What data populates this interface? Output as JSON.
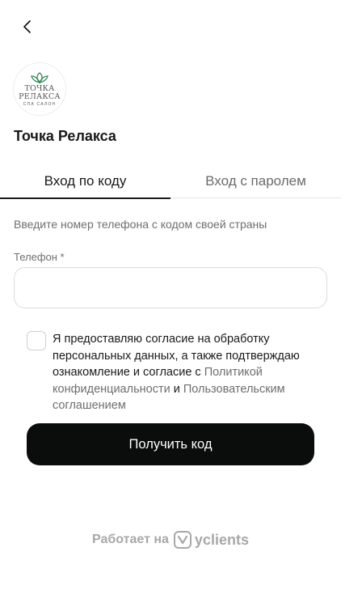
{
  "header": {
    "back_icon": "chevron-left-icon"
  },
  "logo": {
    "line1": "ТОЧКА",
    "line2": "РЕЛАКСА",
    "line3": "СПА САЛОН",
    "accent": "#2e8b57"
  },
  "salon": {
    "name": "Точка Релакса"
  },
  "tabs": [
    {
      "label": "Вход по коду",
      "active": true
    },
    {
      "label": "Вход с паролем",
      "active": false
    }
  ],
  "form": {
    "hint": "Введите номер телефона с кодом своей страны",
    "phone_label": "Телефон *",
    "phone_value": "",
    "phone_placeholder": ""
  },
  "consent": {
    "text_before": "Я предоставляю согласие на обработку персональных данных, а также подтверждаю ознакомление и согласие с ",
    "privacy_link": "Политикой конфиденциальности",
    "text_middle": " и ",
    "terms_link": "Пользовательским соглашением"
  },
  "submit": {
    "label": "Получить код"
  },
  "footer": {
    "powered_by": "Работает на",
    "brand": "yclients",
    "brand_icon": "yclients-logo-icon"
  },
  "colors": {
    "button_bg": "#0a0d0c",
    "text_primary": "#1a1a1a",
    "text_muted": "#6e6e6e"
  }
}
